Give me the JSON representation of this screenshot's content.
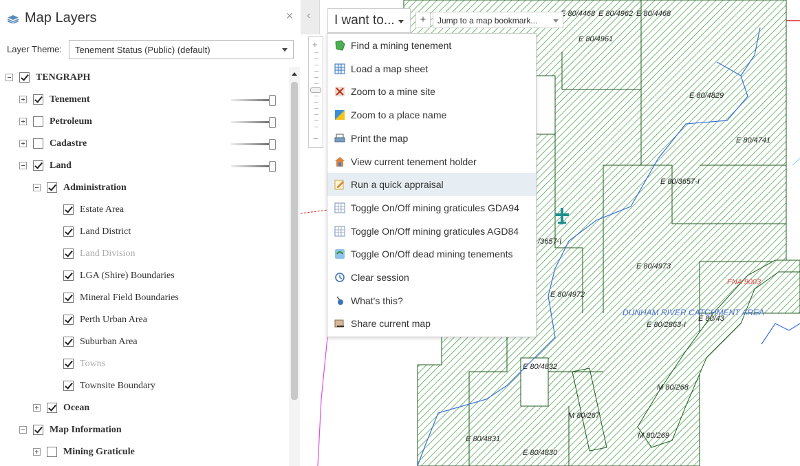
{
  "panel": {
    "title": "Map Layers",
    "close_glyph": "×",
    "theme_label": "Layer Theme:",
    "theme_value": "Tenement Status (Public) (default)"
  },
  "tree": [
    {
      "label": "TENGRAPH",
      "bold": true,
      "checked": true,
      "expander": "minus",
      "level": 0
    },
    {
      "label": "Tenement",
      "bold": true,
      "checked": true,
      "expander": "plus",
      "level": 1,
      "slider": 1.0
    },
    {
      "label": "Petroleum",
      "bold": true,
      "checked": false,
      "expander": "plus",
      "level": 1,
      "slider": 1.0
    },
    {
      "label": "Cadastre",
      "bold": true,
      "checked": false,
      "expander": "plus",
      "level": 1,
      "slider": 1.0
    },
    {
      "label": "Land",
      "bold": true,
      "checked": true,
      "expander": "minus",
      "level": 1,
      "slider": 1.0
    },
    {
      "label": "Administration",
      "bold": true,
      "checked": true,
      "expander": "minus",
      "level": 2
    },
    {
      "label": "Estate Area",
      "bold": false,
      "checked": true,
      "level": 3
    },
    {
      "label": "Land District",
      "bold": false,
      "checked": true,
      "level": 3
    },
    {
      "label": "Land Division",
      "bold": false,
      "checked": true,
      "level": 3,
      "dim": true
    },
    {
      "label": "LGA (Shire) Boundaries",
      "bold": false,
      "checked": true,
      "level": 3
    },
    {
      "label": "Mineral Field Boundaries",
      "bold": false,
      "checked": true,
      "level": 3
    },
    {
      "label": "Perth Urban Area",
      "bold": false,
      "checked": true,
      "level": 3
    },
    {
      "label": "Suburban Area",
      "bold": false,
      "checked": true,
      "level": 3
    },
    {
      "label": "Towns",
      "bold": false,
      "checked": true,
      "level": 3,
      "dim": true
    },
    {
      "label": "Townsite Boundary",
      "bold": false,
      "checked": true,
      "level": 3
    },
    {
      "label": "Ocean",
      "bold": true,
      "checked": true,
      "expander": "plus",
      "level": 2
    },
    {
      "label": "Map Information",
      "bold": true,
      "checked": true,
      "expander": "minus",
      "level": 1
    },
    {
      "label": "Mining Graticule",
      "bold": true,
      "checked": false,
      "expander": "plus",
      "level": 2
    }
  ],
  "toolbar": {
    "iwant_label": "I want to...",
    "plus_glyph": "+",
    "bookmark_placeholder": "Jump to a map bookmark..."
  },
  "zoom": {
    "in_glyph": "+",
    "out_glyph": "−"
  },
  "menu": [
    {
      "label": "Find a mining tenement",
      "icon": "tenement-icon"
    },
    {
      "label": "Load a map sheet",
      "icon": "grid-sheet-icon"
    },
    {
      "label": "Zoom to a mine site",
      "icon": "mine-site-icon"
    },
    {
      "label": "Zoom to a place name",
      "icon": "place-name-icon"
    },
    {
      "label": "Print the map",
      "icon": "printer-icon"
    },
    {
      "label": "View current tenement holder",
      "icon": "holder-icon"
    },
    {
      "label": "Run a quick appraisal",
      "icon": "appraisal-icon",
      "highlighted": true
    },
    {
      "label": "Toggle On/Off mining graticules GDA94",
      "icon": "graticule-icon"
    },
    {
      "label": "Toggle On/Off mining graticules AGD84",
      "icon": "graticule-icon"
    },
    {
      "label": "Toggle On/Off dead mining tenements",
      "icon": "dead-tenement-icon"
    },
    {
      "label": "Clear session",
      "icon": "clear-session-icon"
    },
    {
      "label": "What's this?",
      "icon": "whats-this-icon"
    },
    {
      "label": "Share current map",
      "icon": "share-map-icon"
    }
  ],
  "map_labels": [
    {
      "text": "E 80/4468",
      "color": "black"
    },
    {
      "text": "E 80/4962",
      "color": "black"
    },
    {
      "text": "E 80/4468",
      "color": "black"
    },
    {
      "text": "E 80/4961",
      "color": "black"
    },
    {
      "text": "E 80/4829",
      "color": "black"
    },
    {
      "text": "E 80/4741",
      "color": "black"
    },
    {
      "text": "E 80/3657-I",
      "color": "black"
    },
    {
      "text": "/3657-I",
      "color": "black"
    },
    {
      "text": "E 80/4973",
      "color": "black"
    },
    {
      "text": "E 80/4972",
      "color": "black"
    },
    {
      "text": "FNA 9003",
      "color": "red"
    },
    {
      "text": "DUNHAM RIVER CATCHMENT AREA",
      "color": "blue"
    },
    {
      "text": "E 80/2863-I",
      "color": "black"
    },
    {
      "text": "E 80/43",
      "color": "black"
    },
    {
      "text": "E 80/4832",
      "color": "black"
    },
    {
      "text": "M 80/268",
      "color": "black"
    },
    {
      "text": "M 80/267",
      "color": "black"
    },
    {
      "text": "M 80/269",
      "color": "black"
    },
    {
      "text": "E 80/4831",
      "color": "black"
    },
    {
      "text": "E 80/4830",
      "color": "black"
    }
  ],
  "colors": {
    "tenement_fill": "#3a9b3a",
    "tenement_border": "#1f5a1f",
    "menu_highlight": "#e7eef3",
    "river": "#3a6fd8",
    "red_boundary": "#d9252a",
    "magenta_boundary": "#e14be0"
  }
}
